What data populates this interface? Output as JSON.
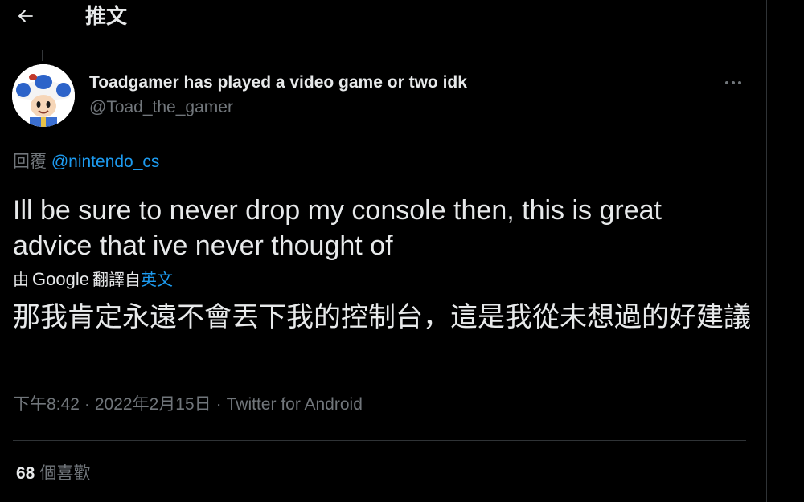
{
  "header": {
    "title": "推文",
    "back_icon": "arrow-left-icon"
  },
  "tweet": {
    "author": {
      "display_name": "Toadgamer has played a video game or two idk",
      "handle": "@Toad_the_gamer",
      "avatar_icon": "toad-avatar"
    },
    "more_icon": "more-horizontal-icon",
    "reply_prefix": "回覆",
    "reply_mention": "@nintendo_cs",
    "text": "Ill be sure to never drop my console then, this is great advice that ive never thought of",
    "translation": {
      "prefix": "由",
      "provider": "Google",
      "middle": "翻譯自",
      "source_language": "英文",
      "text": "那我肯定永遠不會丟下我的控制台，這是我從未想過的好建議"
    },
    "meta": {
      "time": "下午8:42",
      "separator": "·",
      "date": "2022年2月15日",
      "source": "Twitter for Android"
    },
    "stats": {
      "likes_count": "68",
      "likes_label": "個喜歡"
    }
  },
  "colors": {
    "background": "#000000",
    "text_primary": "#e7e9ea",
    "text_secondary": "#71767b",
    "link": "#1d9bf0",
    "border": "#2f3336"
  }
}
